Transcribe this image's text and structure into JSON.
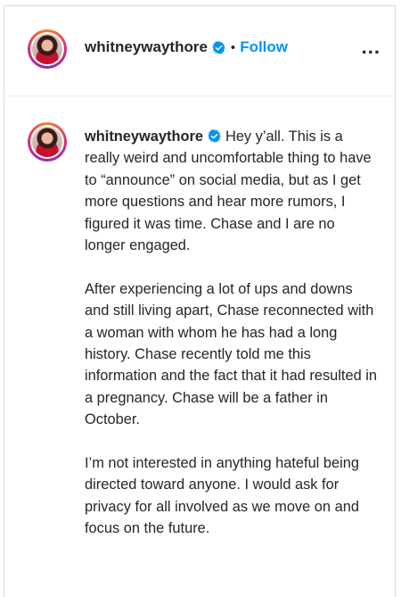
{
  "post": {
    "header": {
      "username": "whitneywaythore",
      "separator": "•",
      "follow_label": "Follow",
      "more_label": "..."
    },
    "caption": {
      "username": "whitneywaythore",
      "paragraphs": [
        "Hey y’all. This is a really weird and uncomfortable thing to have to “announce” on social media, but as I get more questions and hear more rumors, I figured it was time. Chase and I are no longer engaged.",
        "After experiencing a lot of ups and downs and still living apart, Chase reconnected with a woman with whom he has had a long history. Chase recently told me this information and the fact that it had resulted in a pregnancy. Chase will be a father in October.",
        "I’m not interested in anything hateful being directed toward anyone. I would ask for privacy for all involved as we move on and focus on the future."
      ]
    },
    "icons": {
      "verified": "verified-badge-icon",
      "more": "more-options-icon"
    },
    "colors": {
      "accent": "#0095f6",
      "text": "#262626",
      "border": "#dbdbdb"
    }
  }
}
